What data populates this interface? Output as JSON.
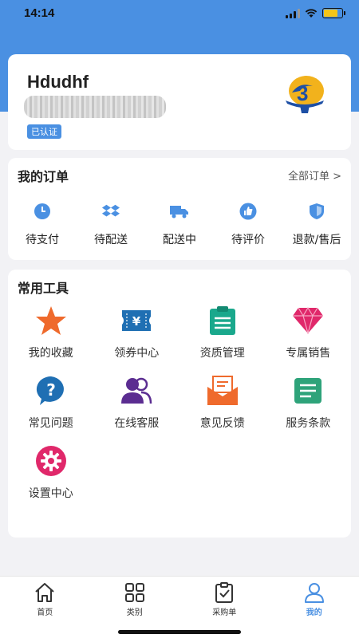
{
  "status_bar": {
    "time": "14:14"
  },
  "profile": {
    "username": "Hdudhf",
    "verified_label": "已认证",
    "logo_icon": "company-logo-icon"
  },
  "orders": {
    "title": "我的订单",
    "view_all": "全部订单 >",
    "items": [
      {
        "label": "待支付",
        "icon": "clock-icon"
      },
      {
        "label": "待配送",
        "icon": "box-icon"
      },
      {
        "label": "配送中",
        "icon": "truck-icon"
      },
      {
        "label": "待评价",
        "icon": "thumbs-up-icon"
      },
      {
        "label": "退款/售后",
        "icon": "shield-icon"
      }
    ]
  },
  "tools": {
    "title": "常用工具",
    "items": [
      {
        "label": "我的收藏",
        "icon": "star-icon",
        "color": "#ef6a2c"
      },
      {
        "label": "领券中心",
        "icon": "coupon-icon",
        "color": "#1f6fb3"
      },
      {
        "label": "资质管理",
        "icon": "clipboard-icon",
        "color": "#1aa88c"
      },
      {
        "label": "专属销售",
        "icon": "diamond-icon",
        "color": "#e0286a"
      },
      {
        "label": "常见问题",
        "icon": "question-icon",
        "color": "#1f6fb3"
      },
      {
        "label": "在线客服",
        "icon": "people-icon",
        "color": "#5b2d91"
      },
      {
        "label": "意见反馈",
        "icon": "envelope-icon",
        "color": "#ef6a2c"
      },
      {
        "label": "服务条款",
        "icon": "document-icon",
        "color": "#2ea37a"
      },
      {
        "label": "设置中心",
        "icon": "gear-icon",
        "color": "#e0286a"
      }
    ]
  },
  "tab_bar": {
    "items": [
      {
        "label": "首页",
        "icon": "home-icon"
      },
      {
        "label": "类别",
        "icon": "grid-icon"
      },
      {
        "label": "采购单",
        "icon": "purchase-list-icon"
      },
      {
        "label": "我的",
        "icon": "user-icon"
      }
    ],
    "active_index": 3,
    "accent_color": "#4a90e2"
  }
}
